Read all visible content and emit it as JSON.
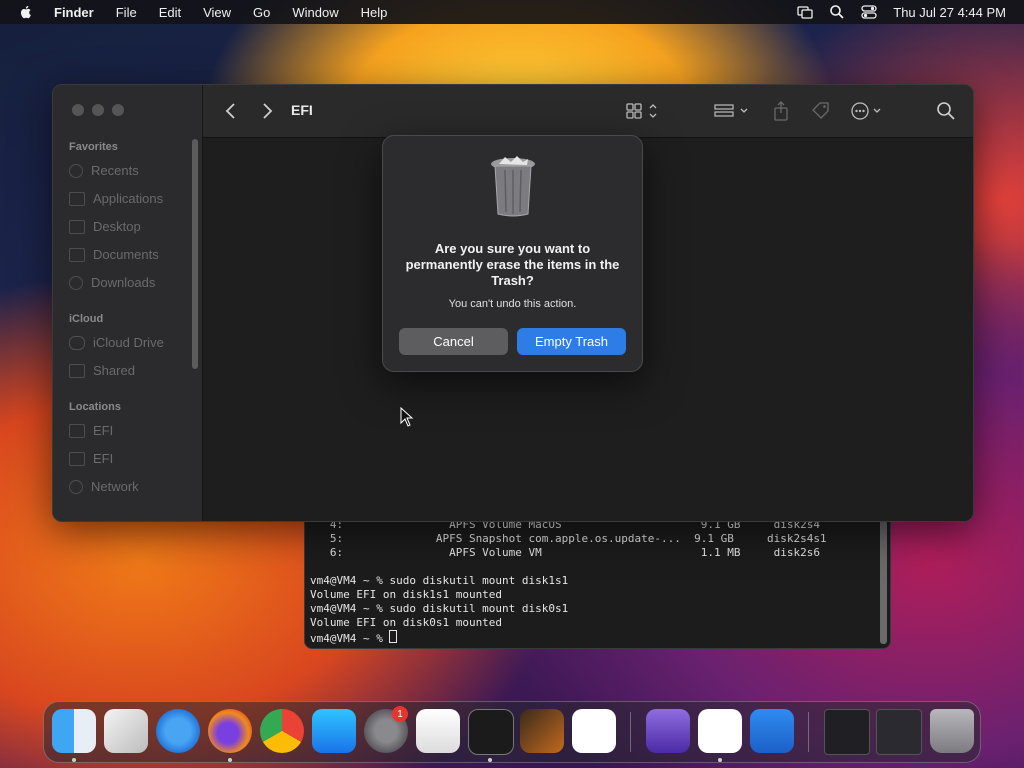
{
  "menubar": {
    "app_name": "Finder",
    "items": [
      "File",
      "Edit",
      "View",
      "Go",
      "Window",
      "Help"
    ],
    "datetime": "Thu Jul 27  4:44 PM"
  },
  "finder": {
    "title": "EFI",
    "sidebar": {
      "favorites_header": "Favorites",
      "favorites": [
        "Recents",
        "Applications",
        "Desktop",
        "Documents",
        "Downloads"
      ],
      "icloud_header": "iCloud",
      "icloud": [
        "iCloud Drive",
        "Shared"
      ],
      "locations_header": "Locations",
      "locations": [
        "EFI",
        "EFI",
        "Network"
      ]
    }
  },
  "dialog": {
    "heading": "Are you sure you want to permanently erase the items in the Trash?",
    "message": "You can't undo this action.",
    "cancel_label": "Cancel",
    "confirm_label": "Empty Trash"
  },
  "terminal": {
    "lines": [
      "   4:                APFS Volume MacOS                     9.1 GB     disk2s4",
      "   5:              APFS Snapshot com.apple.os.update-...  9.1 GB     disk2s4s1",
      "   6:                APFS Volume VM                        1.1 MB     disk2s6",
      "",
      "vm4@VM4 ~ % sudo diskutil mount disk1s1",
      "Volume EFI on disk1s1 mounted",
      "vm4@VM4 ~ % sudo diskutil mount disk0s1",
      "Volume EFI on disk0s1 mounted"
    ],
    "prompt": "vm4@VM4 ~ % "
  },
  "dock": {
    "apps": [
      "Finder",
      "Launchpad",
      "Safari",
      "Firefox",
      "Chrome",
      "App Store",
      "System Settings",
      "TextEdit",
      "Terminal",
      "GarageBand",
      "Visual Studio Code",
      "Simulator",
      "Visual Studio",
      "Keynote",
      "Window Preview 1",
      "Window Preview 2",
      "Trash"
    ],
    "settings_badge": "1"
  },
  "colors": {
    "accent": "#2e7ce6",
    "dialog_bg": "#2c2c2e",
    "window_bg": "#1e1e1e"
  }
}
